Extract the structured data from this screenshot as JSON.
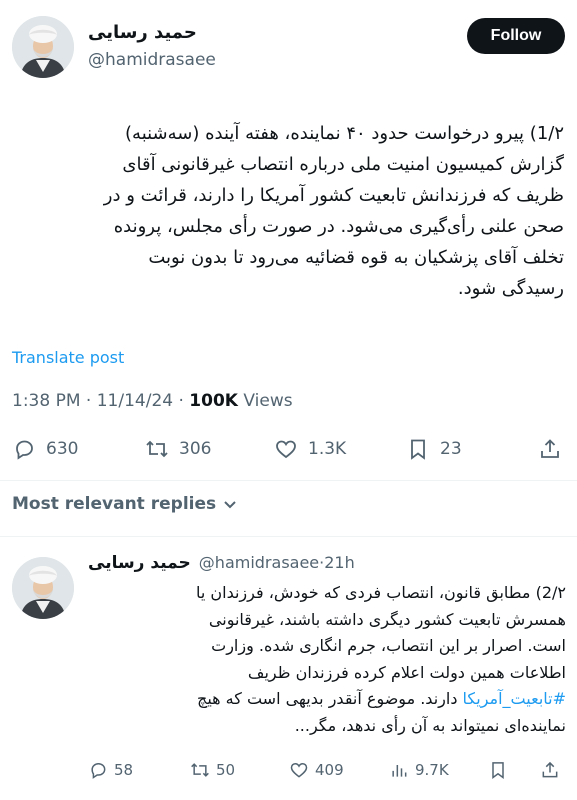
{
  "tweet": {
    "author_name": "حمید رسایی",
    "author_handle": "@hamidrasaee",
    "follow_label": "Follow",
    "text": "1/۲) پیرو درخواست حدود ۴۰ نماینده، هفته آینده (سه‌شنبه)\nگزارش کمیسیون امنیت ملی درباره انتصاب غیرقانونی آقای\nظریف که فرزندانش تابعیت کشور آمریکا را دارند، قرائت و در\nصحن علنی رأی‌گیری می‌شود. در صورت رأی مجلس، پرونده\nتخلف آقای پزشکیان به قوه قضائیه می‌رود تا بدون نوبت\nرسیدگی شود.",
    "translate_label": "Translate post",
    "time": "1:38 PM",
    "date": "11/14/24",
    "views_count": "100K",
    "views_label": "Views",
    "stats": {
      "replies": "630",
      "retweets": "306",
      "likes": "1.3K",
      "bookmarks": "23"
    }
  },
  "replies_section": {
    "label": "Most relevant replies"
  },
  "reply": {
    "author_name": "حمید رسایی",
    "author_handle": "@hamidrasaee",
    "time_ago": "21h",
    "text_before": "2/۲) مطابق قانون، انتصاب فردی که خودش، فرزندان یا\nهمسرش تابعیت کشور دیگری داشته باشند، غیرقانونی\nاست. اصرار بر این انتصاب، جرم انگاری شده. وزارت\nاطلاعات همین دولت اعلام کرده فرزندان ظریف\n",
    "hashtag": "#تابعیت_آمریکا",
    "text_after": " دارند. موضوع آنقدر بدیهی است که هیچ\nنماینده‌ای نمیتواند به آن رأی ندهد، مگر...",
    "stats": {
      "replies": "58",
      "retweets": "50",
      "likes": "409",
      "views": "9.7K"
    }
  },
  "colors": {
    "accent": "#1d9bf0",
    "text": "#0f1419",
    "muted": "#536471",
    "divider": "#eff3f4"
  },
  "icons": [
    "reply-icon",
    "retweet-icon",
    "like-icon",
    "bookmark-icon",
    "share-icon",
    "views-icon",
    "chevron-down-icon"
  ]
}
